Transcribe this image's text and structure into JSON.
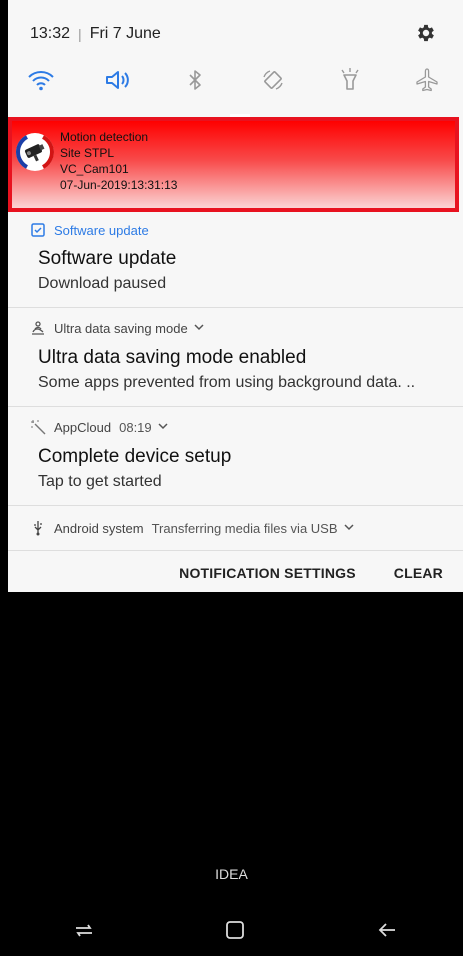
{
  "status": {
    "time": "13:32",
    "separator": "|",
    "date": "Fri 7 June"
  },
  "quick_settings": [
    {
      "name": "wifi-icon",
      "active": true
    },
    {
      "name": "sound-icon",
      "active": true
    },
    {
      "name": "bluetooth-icon",
      "active": false
    },
    {
      "name": "auto-rotate-icon",
      "active": false
    },
    {
      "name": "flashlight-icon",
      "active": false
    },
    {
      "name": "airplane-mode-icon",
      "active": false
    }
  ],
  "motion_notification": {
    "line1": "Motion detection",
    "line2": "Site STPL",
    "line3": "VC_Cam101",
    "line4": "07-Jun-2019:13:31:13"
  },
  "software_update": {
    "app": "Software update",
    "title": "Software update",
    "text": "Download paused"
  },
  "data_saving": {
    "app": "Ultra data saving mode",
    "title": "Ultra data saving mode enabled",
    "text": "Some apps prevented from using background data. .."
  },
  "appcloud": {
    "app": "AppCloud",
    "time": "08:19",
    "title": "Complete device setup",
    "text": "Tap to get started"
  },
  "android_system": {
    "app": "Android system",
    "text": "Transferring media files via USB"
  },
  "actions": {
    "settings": "NOTIFICATION SETTINGS",
    "clear": "CLEAR"
  },
  "carrier": "IDEA",
  "colors": {
    "accent": "#2d7be5",
    "alert_red": "#ff0000",
    "panel_bg": "#f7f7f7"
  }
}
